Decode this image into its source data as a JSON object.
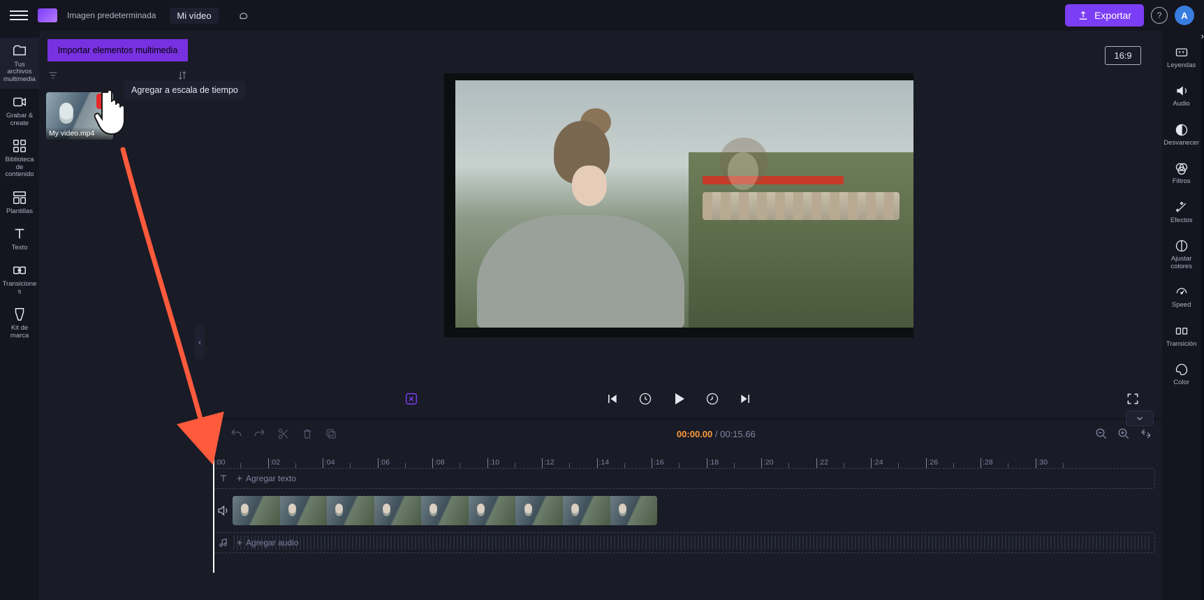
{
  "topbar": {
    "brand": "Imagen predeterminada",
    "project_title": "Mi vídeo",
    "export_label": "Exportar",
    "avatar_initial": "A"
  },
  "sidebar_left": {
    "items": [
      {
        "id": "media",
        "label": "Tus archivos multimedia"
      },
      {
        "id": "record",
        "label": "Grabar &amp; create"
      },
      {
        "id": "library",
        "label": "Biblioteca de contenido"
      },
      {
        "id": "templates",
        "label": "Plantillas"
      },
      {
        "id": "text",
        "label": "Texto"
      },
      {
        "id": "transitions",
        "label": "Transiciones"
      },
      {
        "id": "brandkit",
        "label": "Kit de marca"
      }
    ]
  },
  "media_panel": {
    "import_label": "Importar elementos multimedia",
    "thumb_name": "My video.mp4",
    "tooltip": "Agregar a escala de tiempo"
  },
  "preview": {
    "aspect_label": "16:9"
  },
  "timeline": {
    "current": "00:00.00",
    "total": "00:15.66",
    "ticks": [
      ":00",
      ":02",
      ":04",
      ":06",
      ":08",
      ":10",
      ":12",
      ":14",
      ":16",
      ":18",
      ":20",
      ":22",
      ":24",
      ":26",
      ":28",
      ":30"
    ],
    "text_track_label": "Agregar texto",
    "audio_track_label": "Agregar audio"
  },
  "sidebar_right": {
    "items": [
      {
        "id": "captions",
        "label": "Leyendas"
      },
      {
        "id": "audio",
        "label": "Audio"
      },
      {
        "id": "fade",
        "label": "Desvanecer"
      },
      {
        "id": "filters",
        "label": "Filtros"
      },
      {
        "id": "effects",
        "label": "Efectos"
      },
      {
        "id": "adjust",
        "label": "Ajustar colores"
      },
      {
        "id": "speed",
        "label": "Speed"
      },
      {
        "id": "transition",
        "label": "Transición"
      },
      {
        "id": "color",
        "label": "Color"
      }
    ]
  }
}
